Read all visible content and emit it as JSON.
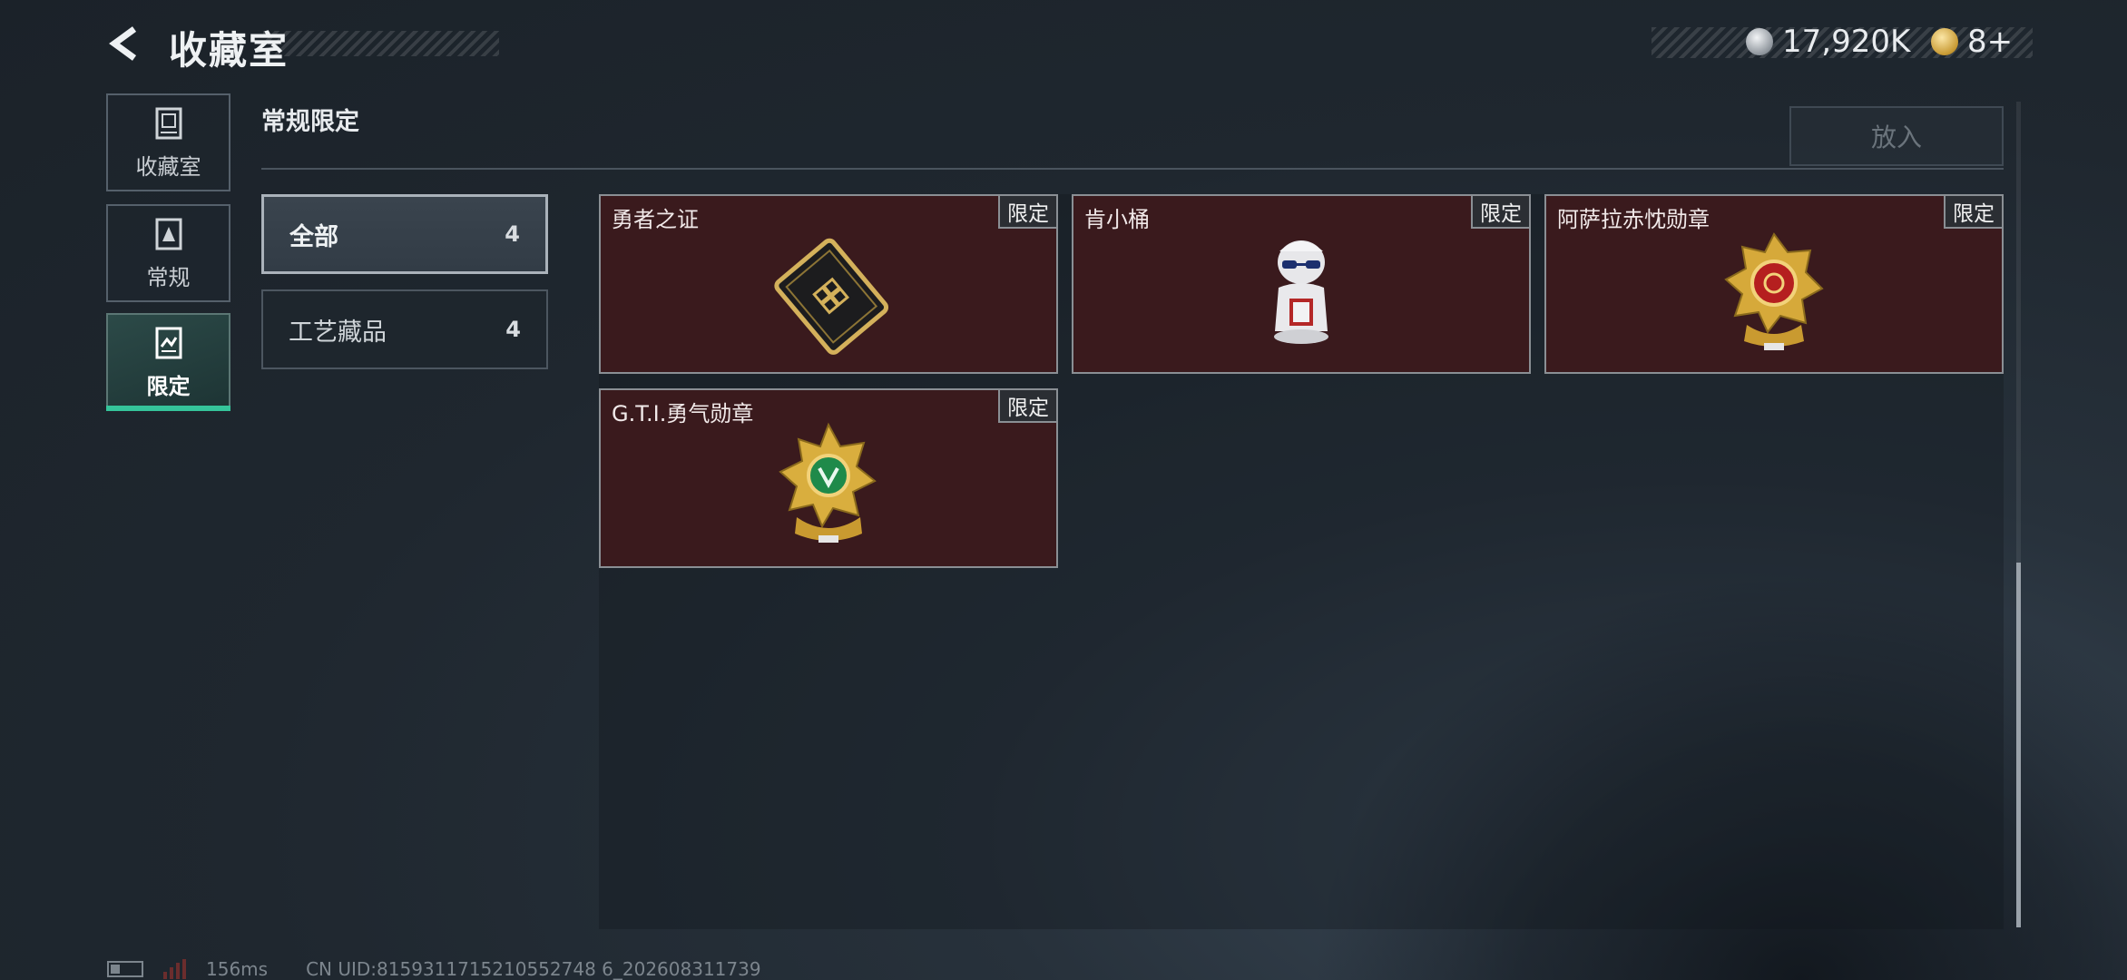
{
  "header": {
    "title": "收藏室",
    "currency": [
      {
        "icon": "silver-coin-icon",
        "value": "17,920K",
        "color": "#c8cdd2"
      },
      {
        "icon": "gold-coin-icon",
        "value": "8+",
        "color": "#d9b24a"
      }
    ]
  },
  "nav": [
    {
      "icon": "collection-room-icon",
      "label": "收藏室"
    },
    {
      "icon": "regular-icon",
      "label": "常规"
    },
    {
      "icon": "limited-icon",
      "label": "限定",
      "active": true
    }
  ],
  "section": {
    "title": "常规限定",
    "put_in_label": "放入"
  },
  "filters": [
    {
      "label": "全部",
      "count": "4",
      "active": true
    },
    {
      "label": "工艺藏品",
      "count": "4"
    }
  ],
  "items": [
    {
      "name": "勇者之证",
      "badge": "限定",
      "icon": "card-icon"
    },
    {
      "name": "肯小桶",
      "badge": "限定",
      "icon": "figure-icon"
    },
    {
      "name": "阿萨拉赤忱勋章",
      "badge": "限定",
      "icon": "red-medal-icon"
    },
    {
      "name": "G.T.I.勇气勋章",
      "badge": "限定",
      "icon": "green-medal-icon"
    }
  ],
  "status": {
    "ping": "156ms",
    "uid": "CN UID:8159311715210552748 6_202608311739"
  },
  "colors": {
    "card_bg": "#3a1a1d",
    "accent": "#35c49a"
  }
}
